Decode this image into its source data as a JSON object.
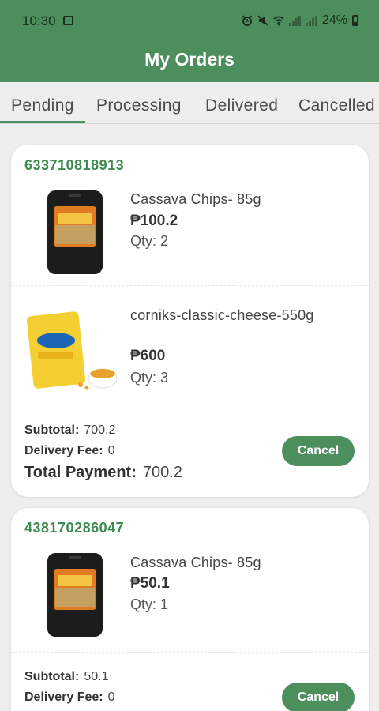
{
  "status_bar": {
    "time": "10:30",
    "battery": "24%"
  },
  "app_bar": {
    "title": "My Orders"
  },
  "tabs": [
    {
      "label": "Pending",
      "active": true
    },
    {
      "label": "Processing"
    },
    {
      "label": "Delivered"
    },
    {
      "label": "Cancelled"
    }
  ],
  "currency": "₱",
  "orders": [
    {
      "id": "633710818913",
      "items": [
        {
          "name": "Cassava Chips- 85g",
          "price": "₱100.2",
          "qty": "Qty: 2"
        },
        {
          "name": "corniks-classic-cheese-550g",
          "price": "₱600",
          "qty": "Qty: 3"
        }
      ],
      "subtotal_label": "Subtotal:",
      "subtotal": "700.2",
      "delivery_label": "Delivery Fee:",
      "delivery": "0",
      "total_label": "Total Payment:",
      "total": "700.2",
      "cancel_label": "Cancel"
    },
    {
      "id": "438170286047",
      "items": [
        {
          "name": "Cassava Chips- 85g",
          "price": "₱50.1",
          "qty": "Qty: 1"
        }
      ],
      "subtotal_label": "Subtotal:",
      "subtotal": "50.1",
      "delivery_label": "Delivery Fee:",
      "delivery": "0",
      "cancel_label": "Cancel"
    }
  ],
  "colors": {
    "primary": "#4c8f5d",
    "order_id": "#3d8b4f",
    "background": "#eeeeee"
  },
  "icons": [
    "gallery-icon",
    "alarm-icon",
    "mute-icon",
    "wifi-icon",
    "signal-icon",
    "battery-icon"
  ]
}
